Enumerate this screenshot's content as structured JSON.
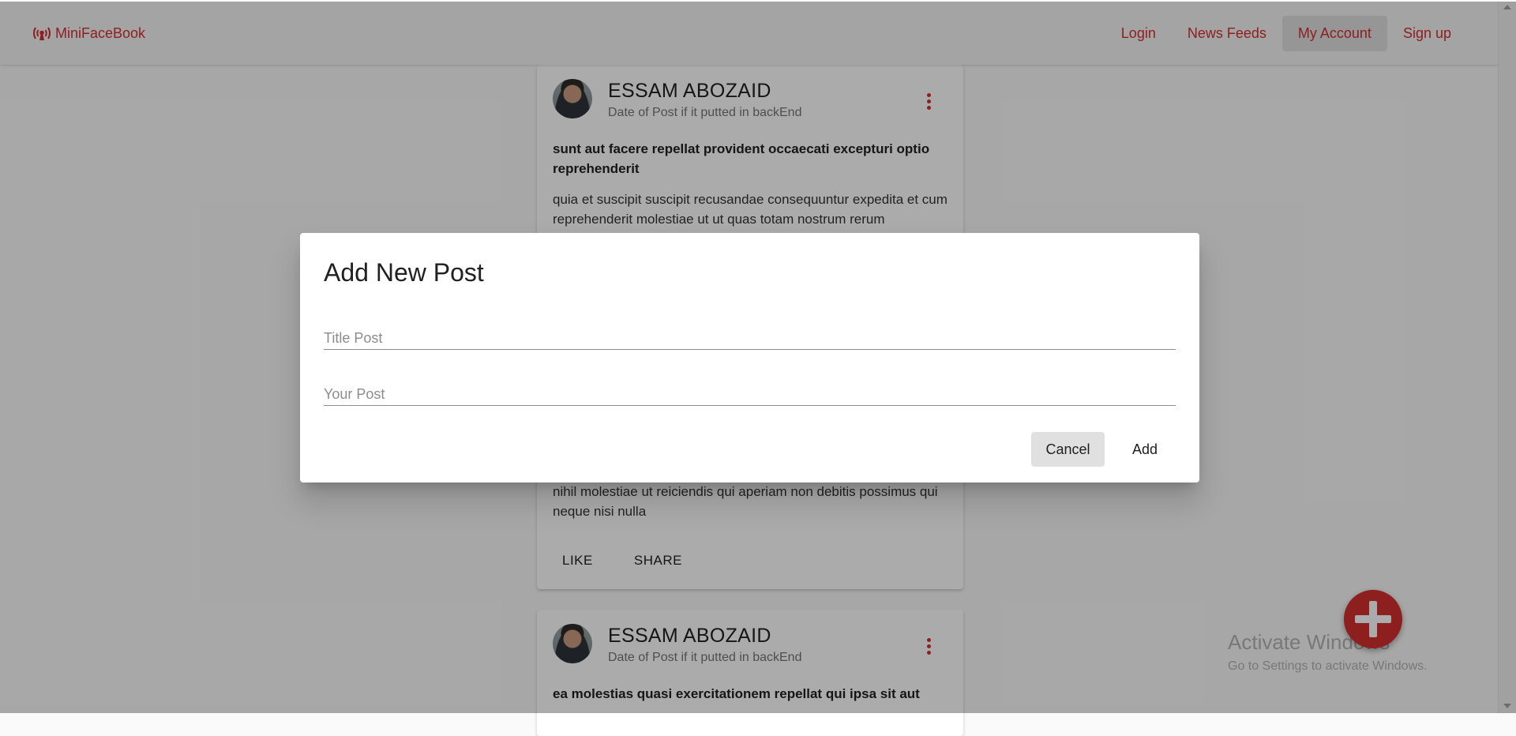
{
  "app": {
    "brand": "MiniFaceBook",
    "nav": [
      {
        "label": "Login",
        "active": false
      },
      {
        "label": "News Feeds",
        "active": false
      },
      {
        "label": "My Account",
        "active": true
      },
      {
        "label": "Sign up",
        "active": false
      }
    ],
    "accent_color": "#d32f2f"
  },
  "posts": [
    {
      "author": "ESSAM ABOZAID",
      "date": "Date of Post if it putted in backEnd",
      "title": "sunt aut facere repellat provident occaecati excepturi optio reprehenderit",
      "body_top": "quia et suscipit suscipit recusandae consequuntur expedita et cum reprehenderit molestiae ut ut quas totam nostrum rerum",
      "body_bottom": "nihil molestiae ut reiciendis qui aperiam non debitis possimus qui neque nisi nulla",
      "like_label": "LIKE",
      "share_label": "SHARE"
    },
    {
      "author": "ESSAM ABOZAID",
      "date": "Date of Post if it putted in backEnd",
      "title": "ea molestias quasi exercitationem repellat qui ipsa sit aut"
    }
  ],
  "fab": {
    "icon": "plus-icon"
  },
  "watermark": {
    "line1": "Activate Windows",
    "line2": "Go to Settings to activate Windows."
  },
  "dialog": {
    "title": "Add New Post",
    "title_field": {
      "value": "",
      "placeholder": "Title Post"
    },
    "body_field": {
      "value": "",
      "placeholder": "Your Post"
    },
    "cancel_label": "Cancel",
    "add_label": "Add"
  }
}
